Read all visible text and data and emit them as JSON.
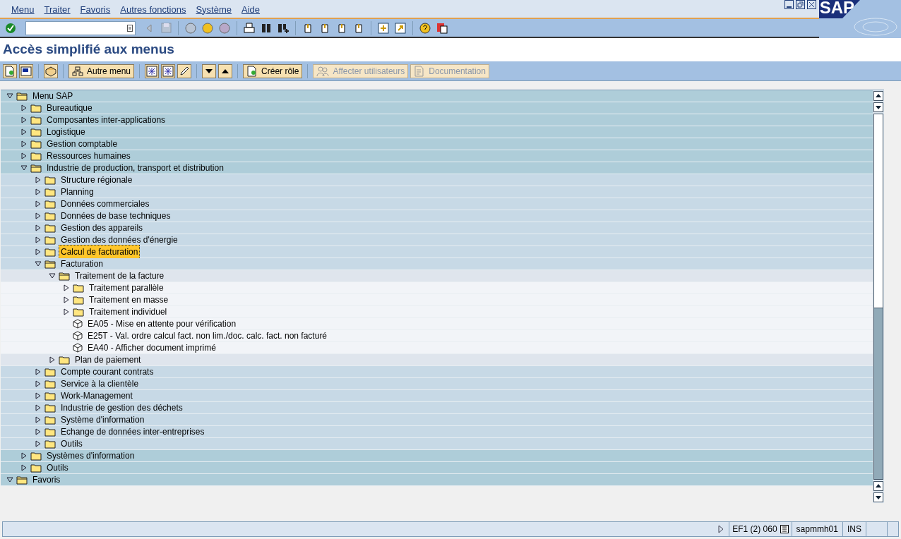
{
  "menu_bar": [
    "Menu",
    "Traiter",
    "Favoris",
    "Autres fonctions",
    "Système",
    "Aide"
  ],
  "logo": "SAP",
  "title": "Accès simplifié aux menus",
  "app_toolbar": [
    {
      "kind": "icon"
    },
    {
      "kind": "icon"
    },
    {
      "kind": "sep"
    },
    {
      "kind": "icon"
    },
    {
      "kind": "sep"
    },
    {
      "kind": "button",
      "label": "Autre menu",
      "disabled": false
    },
    {
      "kind": "sep"
    },
    {
      "kind": "icon"
    },
    {
      "kind": "icon"
    },
    {
      "kind": "icon"
    },
    {
      "kind": "sep"
    },
    {
      "kind": "icon"
    },
    {
      "kind": "icon"
    },
    {
      "kind": "sep"
    },
    {
      "kind": "button",
      "label": "Créer rôle",
      "disabled": false
    },
    {
      "kind": "sep"
    },
    {
      "kind": "button",
      "label": "Affecter utilisateurs",
      "disabled": true
    },
    {
      "kind": "button",
      "label": "Documentation",
      "disabled": true
    }
  ],
  "tree": [
    {
      "kind": "folder",
      "label": "Menu SAP",
      "expanded": true,
      "selected": false,
      "children": [
        {
          "kind": "folder",
          "label": "Bureautique",
          "expanded": false,
          "selected": false
        },
        {
          "kind": "folder",
          "label": "Composantes inter-applications",
          "expanded": false,
          "selected": false
        },
        {
          "kind": "folder",
          "label": "Logistique",
          "expanded": false,
          "selected": false
        },
        {
          "kind": "folder",
          "label": "Gestion comptable",
          "expanded": false,
          "selected": false
        },
        {
          "kind": "folder",
          "label": "Ressources humaines",
          "expanded": false,
          "selected": false
        },
        {
          "kind": "folder",
          "label": "Industrie de production, transport et distribution",
          "expanded": true,
          "selected": false,
          "children": [
            {
              "kind": "folder",
              "label": "Structure régionale",
              "expanded": false,
              "selected": false
            },
            {
              "kind": "folder",
              "label": "Planning",
              "expanded": false,
              "selected": false
            },
            {
              "kind": "folder",
              "label": "Données commerciales",
              "expanded": false,
              "selected": false
            },
            {
              "kind": "folder",
              "label": "Données de base techniques",
              "expanded": false,
              "selected": false
            },
            {
              "kind": "folder",
              "label": "Gestion des appareils",
              "expanded": false,
              "selected": false
            },
            {
              "kind": "folder",
              "label": "Gestion des données d'énergie",
              "expanded": false,
              "selected": false
            },
            {
              "kind": "folder",
              "label": "Calcul de facturation",
              "expanded": false,
              "selected": true
            },
            {
              "kind": "folder",
              "label": "Facturation",
              "expanded": true,
              "selected": false,
              "children": [
                {
                  "kind": "folder",
                  "label": "Traitement de la facture",
                  "expanded": true,
                  "selected": false,
                  "children": [
                    {
                      "kind": "folder",
                      "label": "Traitement parallèle",
                      "expanded": false,
                      "selected": false
                    },
                    {
                      "kind": "folder",
                      "label": "Traitement en masse",
                      "expanded": false,
                      "selected": false
                    },
                    {
                      "kind": "folder",
                      "label": "Traitement individuel",
                      "expanded": false,
                      "selected": false
                    },
                    {
                      "kind": "transaction",
                      "label": "EA05 - Mise en attente pour vérification",
                      "selected": false
                    },
                    {
                      "kind": "transaction",
                      "label": "E25T - Val. ordre calcul fact. non lim./doc. calc. fact. non facturé",
                      "selected": false
                    },
                    {
                      "kind": "transaction",
                      "label": "EA40 - Afficher document imprimé",
                      "selected": false
                    }
                  ]
                },
                {
                  "kind": "folder",
                  "label": "Plan de paiement",
                  "expanded": false,
                  "selected": false
                }
              ]
            },
            {
              "kind": "folder",
              "label": "Compte courant contrats",
              "expanded": false,
              "selected": false
            },
            {
              "kind": "folder",
              "label": "Service à la clientèle",
              "expanded": false,
              "selected": false
            },
            {
              "kind": "folder",
              "label": "Work-Management",
              "expanded": false,
              "selected": false
            },
            {
              "kind": "folder",
              "label": "Industrie de gestion des déchets",
              "expanded": false,
              "selected": false
            },
            {
              "kind": "folder",
              "label": "Système d'information",
              "expanded": false,
              "selected": false
            },
            {
              "kind": "folder",
              "label": "Echange de données inter-entreprises",
              "expanded": false,
              "selected": false
            },
            {
              "kind": "folder",
              "label": "Outils",
              "expanded": false,
              "selected": false
            }
          ]
        },
        {
          "kind": "folder",
          "label": "Systèmes d'information",
          "expanded": false,
          "selected": false
        },
        {
          "kind": "folder",
          "label": "Outils",
          "expanded": false,
          "selected": false
        }
      ]
    },
    {
      "kind": "folder",
      "label": "Favoris",
      "expanded": true,
      "selected": false
    }
  ],
  "status_bar": {
    "system": "EF1 (2) 060",
    "server": "sapmmh01",
    "mode": "INS"
  }
}
